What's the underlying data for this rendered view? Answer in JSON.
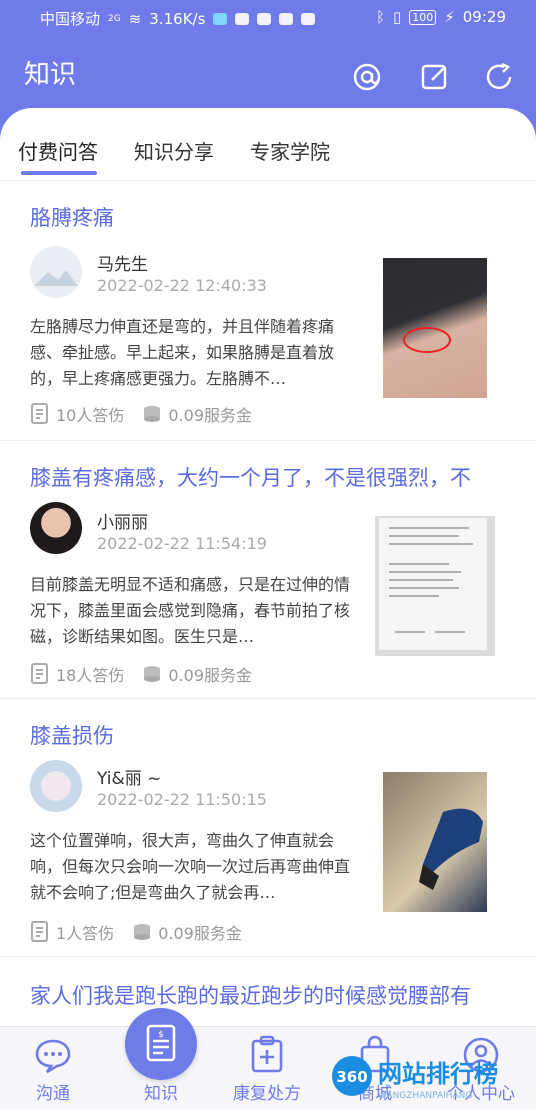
{
  "status_bar": {
    "carrier": "中国移动",
    "network": "2G",
    "speed": "3.16K/s",
    "battery": "100",
    "time": "09:29"
  },
  "header": {
    "title": "知识",
    "icons": [
      "at-icon",
      "edit-icon",
      "refresh-icon"
    ]
  },
  "tabs": [
    {
      "label": "付费问答",
      "active": true
    },
    {
      "label": "知识分享",
      "active": false
    },
    {
      "label": "专家学院",
      "active": false
    }
  ],
  "posts": [
    {
      "title": "胳膊疼痛",
      "user": "马先生",
      "time": "2022-02-22 12:40:33",
      "desc": "左胳膊尽力伸直还是弯的，并且伴随着疼痛感、牵扯感。早上起来，如果胳膊是直着放的，早上疼痛感更强力。左胳膊不…",
      "answers": "10人答伤",
      "fee": "0.09服务金"
    },
    {
      "title": "膝盖有疼痛感，大约一个月了，不是很强烈，不",
      "user": "小丽丽",
      "time": "2022-02-22 11:54:19",
      "desc": "目前膝盖无明显不适和痛感，只是在过伸的情况下，膝盖里面会感觉到隐痛，春节前拍了核磁，诊断结果如图。医生只是…",
      "answers": "18人答伤",
      "fee": "0.09服务金"
    },
    {
      "title": "膝盖损伤",
      "user": "Yi&丽 ~",
      "time": "2022-02-22 11:50:15",
      "desc": "这个位置弹响，很大声，弯曲久了伸直就会响，但每次只会响一次响一次过后再弯曲伸直就不会响了;但是弯曲久了就会再…",
      "answers": "1人答伤",
      "fee": "0.09服务金"
    },
    {
      "title": "家人们我是跑长跑的最近跑步的时候感觉腰部有"
    }
  ],
  "nav": [
    {
      "label": "沟通"
    },
    {
      "label": "知识"
    },
    {
      "label": "康复处方"
    },
    {
      "label": "商城"
    },
    {
      "label": "个人中心"
    }
  ],
  "watermark": {
    "text": "网站排行榜",
    "badge": "360",
    "sub": "WANGZHANPAIHANG"
  }
}
